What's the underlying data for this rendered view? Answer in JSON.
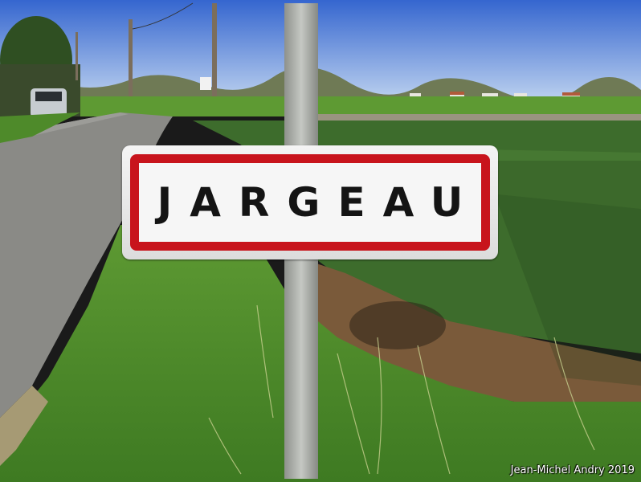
{
  "sign": {
    "town_name": "JARGEAU",
    "border_color": "#c8141c",
    "background_color": "#f6f6f6"
  },
  "credit": {
    "text": "Jean-Michel Andry 2019"
  },
  "colors": {
    "sky": "#3f6fd0",
    "grass": "#4e8a2a",
    "crops": "#3f7030",
    "road": "#8c8c8c",
    "post": "#a8aaa6"
  }
}
